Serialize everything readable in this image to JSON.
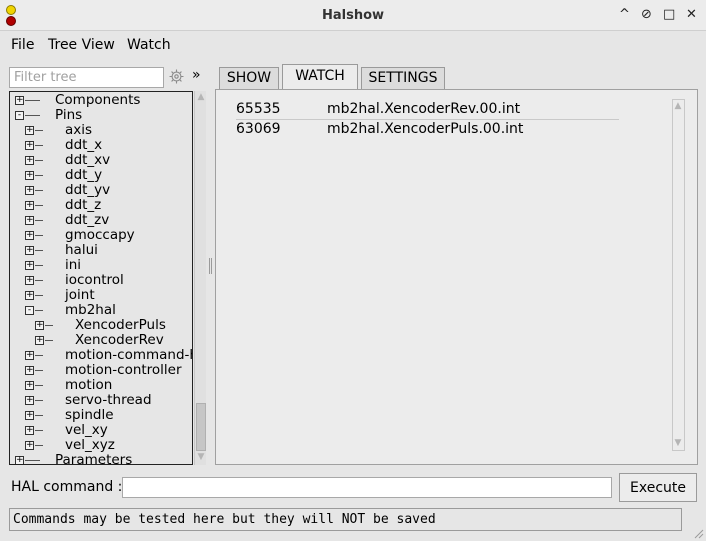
{
  "window": {
    "title": "Halshow",
    "controls": [
      "^",
      "⊘",
      "□",
      "✕"
    ]
  },
  "menu": [
    "File",
    "Tree View",
    "Watch"
  ],
  "filter": {
    "placeholder": "Filter tree",
    "expand_label": "»"
  },
  "tree": [
    {
      "label": "Components",
      "level": 0,
      "toggle": "+"
    },
    {
      "label": "Pins",
      "level": 0,
      "toggle": "-"
    },
    {
      "label": "axis",
      "level": 1,
      "toggle": "+"
    },
    {
      "label": "ddt_x",
      "level": 1,
      "toggle": "+"
    },
    {
      "label": "ddt_xv",
      "level": 1,
      "toggle": "+"
    },
    {
      "label": "ddt_y",
      "level": 1,
      "toggle": "+"
    },
    {
      "label": "ddt_yv",
      "level": 1,
      "toggle": "+"
    },
    {
      "label": "ddt_z",
      "level": 1,
      "toggle": "+"
    },
    {
      "label": "ddt_zv",
      "level": 1,
      "toggle": "+"
    },
    {
      "label": "gmoccapy",
      "level": 1,
      "toggle": "+"
    },
    {
      "label": "halui",
      "level": 1,
      "toggle": "+"
    },
    {
      "label": "ini",
      "level": 1,
      "toggle": "+"
    },
    {
      "label": "iocontrol",
      "level": 1,
      "toggle": "+"
    },
    {
      "label": "joint",
      "level": 1,
      "toggle": "+"
    },
    {
      "label": "mb2hal",
      "level": 1,
      "toggle": "-"
    },
    {
      "label": "XencoderPuls",
      "level": 2,
      "toggle": "+"
    },
    {
      "label": "XencoderRev",
      "level": 2,
      "toggle": "+"
    },
    {
      "label": "motion-command-h",
      "level": 1,
      "toggle": "+"
    },
    {
      "label": "motion-controller",
      "level": 1,
      "toggle": "+"
    },
    {
      "label": "motion",
      "level": 1,
      "toggle": "+"
    },
    {
      "label": "servo-thread",
      "level": 1,
      "toggle": "+"
    },
    {
      "label": "spindle",
      "level": 1,
      "toggle": "+"
    },
    {
      "label": "vel_xy",
      "level": 1,
      "toggle": "+"
    },
    {
      "label": "vel_xyz",
      "level": 1,
      "toggle": "+"
    },
    {
      "label": "Parameters",
      "level": 0,
      "toggle": "+"
    }
  ],
  "tabs": {
    "show": "SHOW",
    "watch": "WATCH",
    "settings": "SETTINGS",
    "active": "WATCH"
  },
  "watch": [
    {
      "value": "65535",
      "name": "mb2hal.XencoderRev.00.int"
    },
    {
      "value": "63069",
      "name": "mb2hal.XencoderPuls.00.int"
    }
  ],
  "hal": {
    "label": "HAL command :",
    "value": "",
    "execute_label": "Execute"
  },
  "status": "Commands may be tested here but they will NOT be saved",
  "icons": {
    "filter_settings": "gear-icon",
    "expand": "double-chevron-icon"
  }
}
